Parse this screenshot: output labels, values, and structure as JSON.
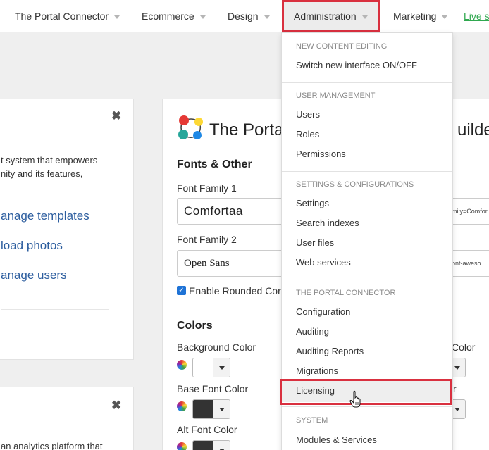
{
  "nav": {
    "items": [
      {
        "label": "The Portal Connector"
      },
      {
        "label": "Ecommerce"
      },
      {
        "label": "Design"
      },
      {
        "label": "Administration"
      },
      {
        "label": "Marketing"
      }
    ],
    "live_site": "Live si"
  },
  "left_panel_1": {
    "close": "✖",
    "text_line_1": "t system that empowers",
    "text_line_2": "nity and its features,",
    "links": [
      "anage templates",
      "load photos",
      "anage users"
    ]
  },
  "left_panel_2": {
    "close": "✖",
    "text_line_1": "an analytics platform that"
  },
  "builder": {
    "title": "The Porta",
    "title_right": "uilde",
    "fonts_heading": "Fonts & Other",
    "font_family_1_label": "Font Family 1",
    "font_family_1_value": "Comfortaa",
    "font_family_1_url": "mily=Comfor",
    "font_family_2_label": "Font Family 2",
    "font_family_2_value": "Open Sans",
    "font_family_2_url": "ont-aweso",
    "rounded_checkbox_label": "Enable Rounded Cor",
    "colors_heading": "Colors",
    "background_color_label": "Background Color",
    "base_font_color_label": "Base Font Color",
    "alt_font_color_label": "Alt Font Color",
    "right_color_label_1": "Color",
    "right_color_label_2": "r",
    "swatch_colors": {
      "background": "#ffffff",
      "base_font": "#333333",
      "alt_font": "#333333"
    }
  },
  "dropdown": {
    "sections": [
      {
        "heading": "NEW CONTENT EDITING",
        "items": [
          "Switch new interface ON/OFF"
        ]
      },
      {
        "heading": "USER MANAGEMENT",
        "items": [
          "Users",
          "Roles",
          "Permissions"
        ]
      },
      {
        "heading": "SETTINGS & CONFIGURATIONS",
        "items": [
          "Settings",
          "Search indexes",
          "User files",
          "Web services"
        ]
      },
      {
        "heading": "THE PORTAL CONNECTOR",
        "items": [
          "Configuration",
          "Auditing",
          "Auditing Reports",
          "Migrations",
          "Licensing"
        ]
      },
      {
        "heading": "SYSTEM",
        "items": [
          "Modules & Services"
        ]
      }
    ]
  },
  "colors": {
    "highlight": "#d9303f",
    "link": "#2c5d9e",
    "live_site": "#2fa84f",
    "checkbox": "#1f73d6"
  }
}
